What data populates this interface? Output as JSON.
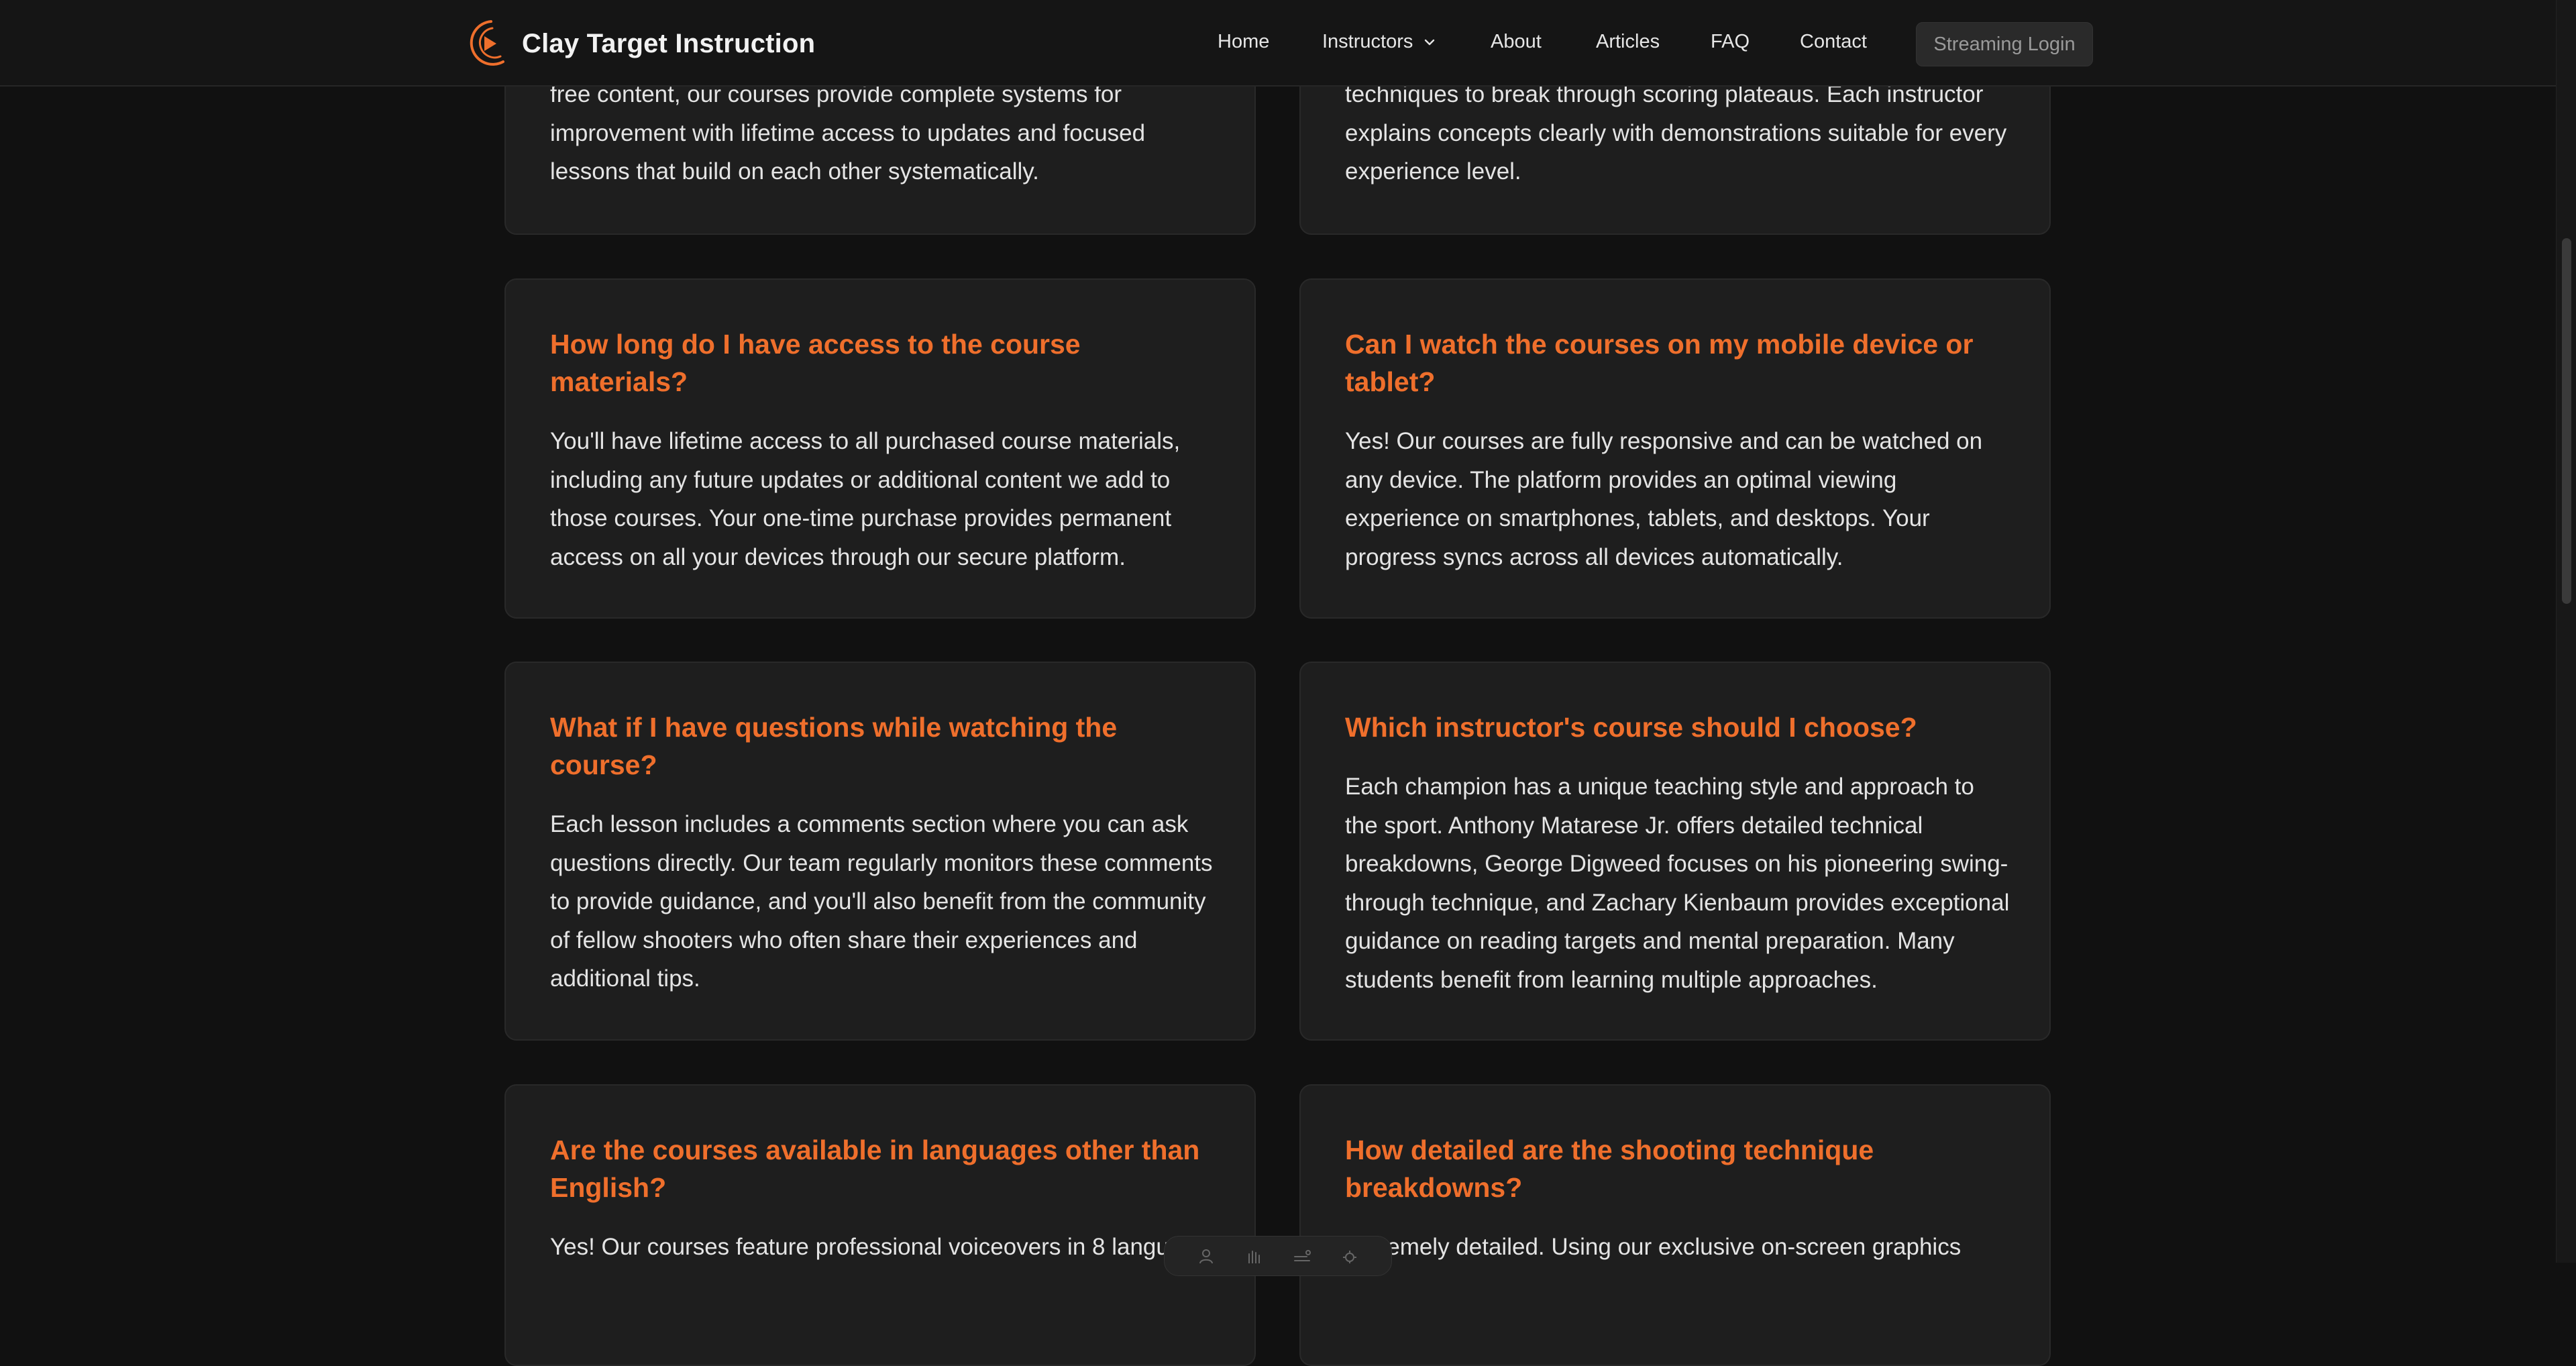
{
  "header": {
    "brand_name": "Clay Target Instruction",
    "accent_color": "#ef6f2c",
    "nav": {
      "home": "Home",
      "instructors": "Instructors",
      "about": "About",
      "articles": "Articles",
      "faq": "FAQ",
      "contact": "Contact"
    },
    "login_label": "Streaming Login"
  },
  "faq": {
    "row0_left": {
      "question": "",
      "answer": "free content, our courses provide complete systems for improvement with lifetime access to updates and focused lessons that build on each other systematically."
    },
    "row0_right": {
      "question": "",
      "answer": "techniques to break through scoring plateaus. Each instructor explains concepts clearly with demonstrations suitable for every experience level."
    },
    "row1_left": {
      "question": "How long do I have access to the course materials?",
      "answer": "You'll have lifetime access to all purchased course materials, including any future updates or additional content we add to those courses. Your one-time purchase provides permanent access on all your devices through our secure platform."
    },
    "row1_right": {
      "question": "Can I watch the courses on my mobile device or tablet?",
      "answer": "Yes! Our courses are fully responsive and can be watched on any device. The platform provides an optimal viewing experience on smartphones, tablets, and desktops. Your progress syncs across all devices automatically."
    },
    "row2_left": {
      "question": "What if I have questions while watching the course?",
      "answer": "Each lesson includes a comments section where you can ask questions directly. Our team regularly monitors these comments to provide guidance, and you'll also benefit from the community of fellow shooters who often share their experiences and additional tips."
    },
    "row2_right": {
      "question": "Which instructor's course should I choose?",
      "answer": "Each champion has a unique teaching style and approach to the sport. Anthony Matarese Jr. offers detailed technical breakdowns, George Digweed focuses on his pioneering swing-through technique, and Zachary Kienbaum provides exceptional guidance on reading targets and mental preparation. Many students benefit from learning multiple approaches."
    },
    "row3_left": {
      "question": "Are the courses available in languages other than English?",
      "answer": "Yes! Our courses feature professional voiceovers in 8 languag"
    },
    "row3_right": {
      "question": "How detailed are the shooting technique breakdowns?",
      "answer": "Extremely detailed. Using our exclusive on-screen graphics"
    }
  },
  "toolbar": {
    "icons": [
      "person-icon",
      "hand-icon",
      "lines-icon",
      "gear-icon"
    ]
  }
}
